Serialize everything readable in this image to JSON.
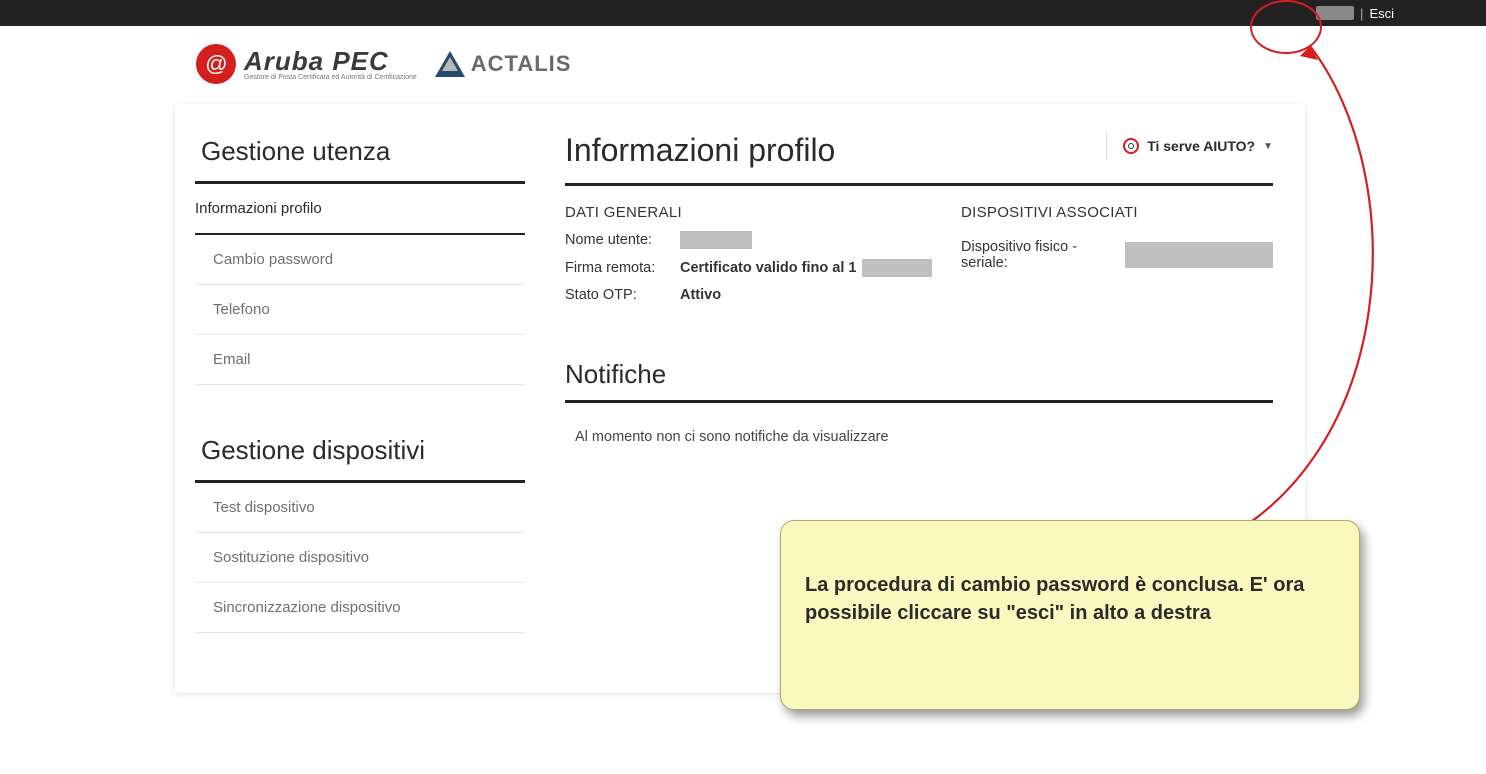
{
  "topbar": {
    "logout": "Esci"
  },
  "logos": {
    "aruba_big": "Aruba PEC",
    "aruba_small": "Gestore di Posta Certificata ed Autorità di Certificazione",
    "actalis": "ACTALIS"
  },
  "sidebar": {
    "group1_title": "Gestione utenza",
    "items1": [
      {
        "label": "Informazioni profilo",
        "active": true
      },
      {
        "label": "Cambio password"
      },
      {
        "label": "Telefono"
      },
      {
        "label": "Email"
      }
    ],
    "group2_title": "Gestione dispositivi",
    "items2": [
      {
        "label": "Test dispositivo"
      },
      {
        "label": "Sostituzione dispositivo"
      },
      {
        "label": "Sincronizzazione dispositivo"
      }
    ]
  },
  "main": {
    "title": "Informazioni profilo",
    "help_label": "Ti serve AIUTO?",
    "general_heading": "DATI GENERALI",
    "kv": {
      "k1": "Nome utente:",
      "k2": "Firma remota:",
      "k3": "Stato OTP:",
      "v2_prefix": "Certificato valido fino al 1",
      "v3": "Attivo"
    },
    "devices_heading": "DISPOSITIVI ASSOCIATI",
    "device_label": "Dispositivo fisico - seriale:",
    "notif_title": "Notifiche",
    "notif_msg": "Al momento non ci sono notifiche da visualizzare"
  },
  "callout": {
    "text": "La procedura di cambio password è conclusa. E' ora possibile cliccare su \"esci\" in alto a destra"
  }
}
